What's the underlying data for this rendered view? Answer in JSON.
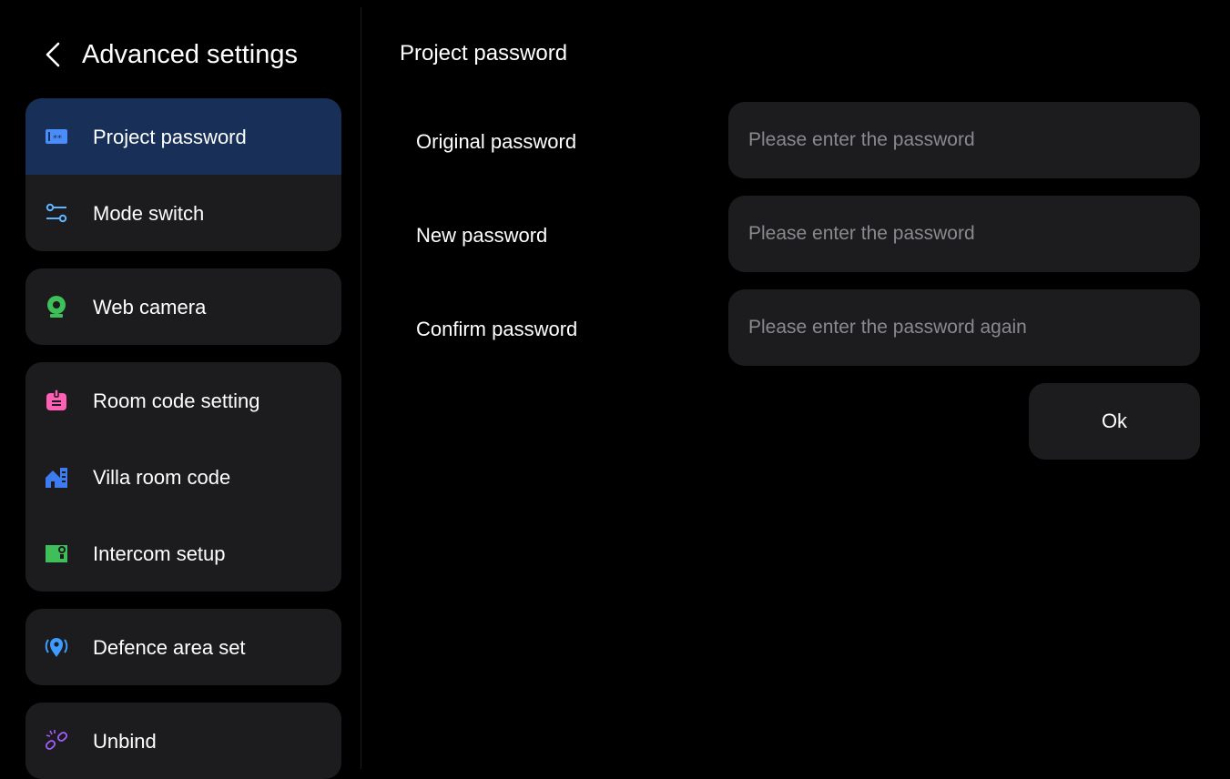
{
  "header": {
    "title": "Advanced settings"
  },
  "sidebar": {
    "groups": [
      {
        "items": [
          {
            "label": "Project password",
            "icon": "password-icon",
            "active": true
          },
          {
            "label": "Mode switch",
            "icon": "mode-switch-icon"
          }
        ]
      },
      {
        "items": [
          {
            "label": "Web camera",
            "icon": "webcam-icon"
          }
        ]
      },
      {
        "items": [
          {
            "label": "Room code setting",
            "icon": "room-code-icon"
          },
          {
            "label": "Villa room code",
            "icon": "villa-icon"
          },
          {
            "label": "Intercom setup",
            "icon": "intercom-icon"
          }
        ]
      },
      {
        "items": [
          {
            "label": "Defence area set",
            "icon": "location-pin-icon"
          }
        ]
      },
      {
        "items": [
          {
            "label": "Unbind",
            "icon": "unlink-icon"
          }
        ]
      }
    ]
  },
  "main": {
    "title": "Project password",
    "fields": [
      {
        "label": "Original password",
        "placeholder": "Please enter the password"
      },
      {
        "label": "New password",
        "placeholder": "Please enter the password"
      },
      {
        "label": "Confirm password",
        "placeholder": "Please enter the password again"
      }
    ],
    "ok_label": "Ok"
  },
  "colors": {
    "background": "#000000",
    "card": "#1c1c1e",
    "active": "#183057",
    "placeholder": "#8a8a8e",
    "icon_password": "#4a8df8",
    "icon_mode": "#5fb3ff",
    "icon_webcam": "#3fbf5a",
    "icon_room": "#ff5fb4",
    "icon_villa": "#3d7bf0",
    "icon_intercom": "#3fbf5a",
    "icon_pin": "#3d9cff",
    "icon_unlink": "#a45cff"
  }
}
